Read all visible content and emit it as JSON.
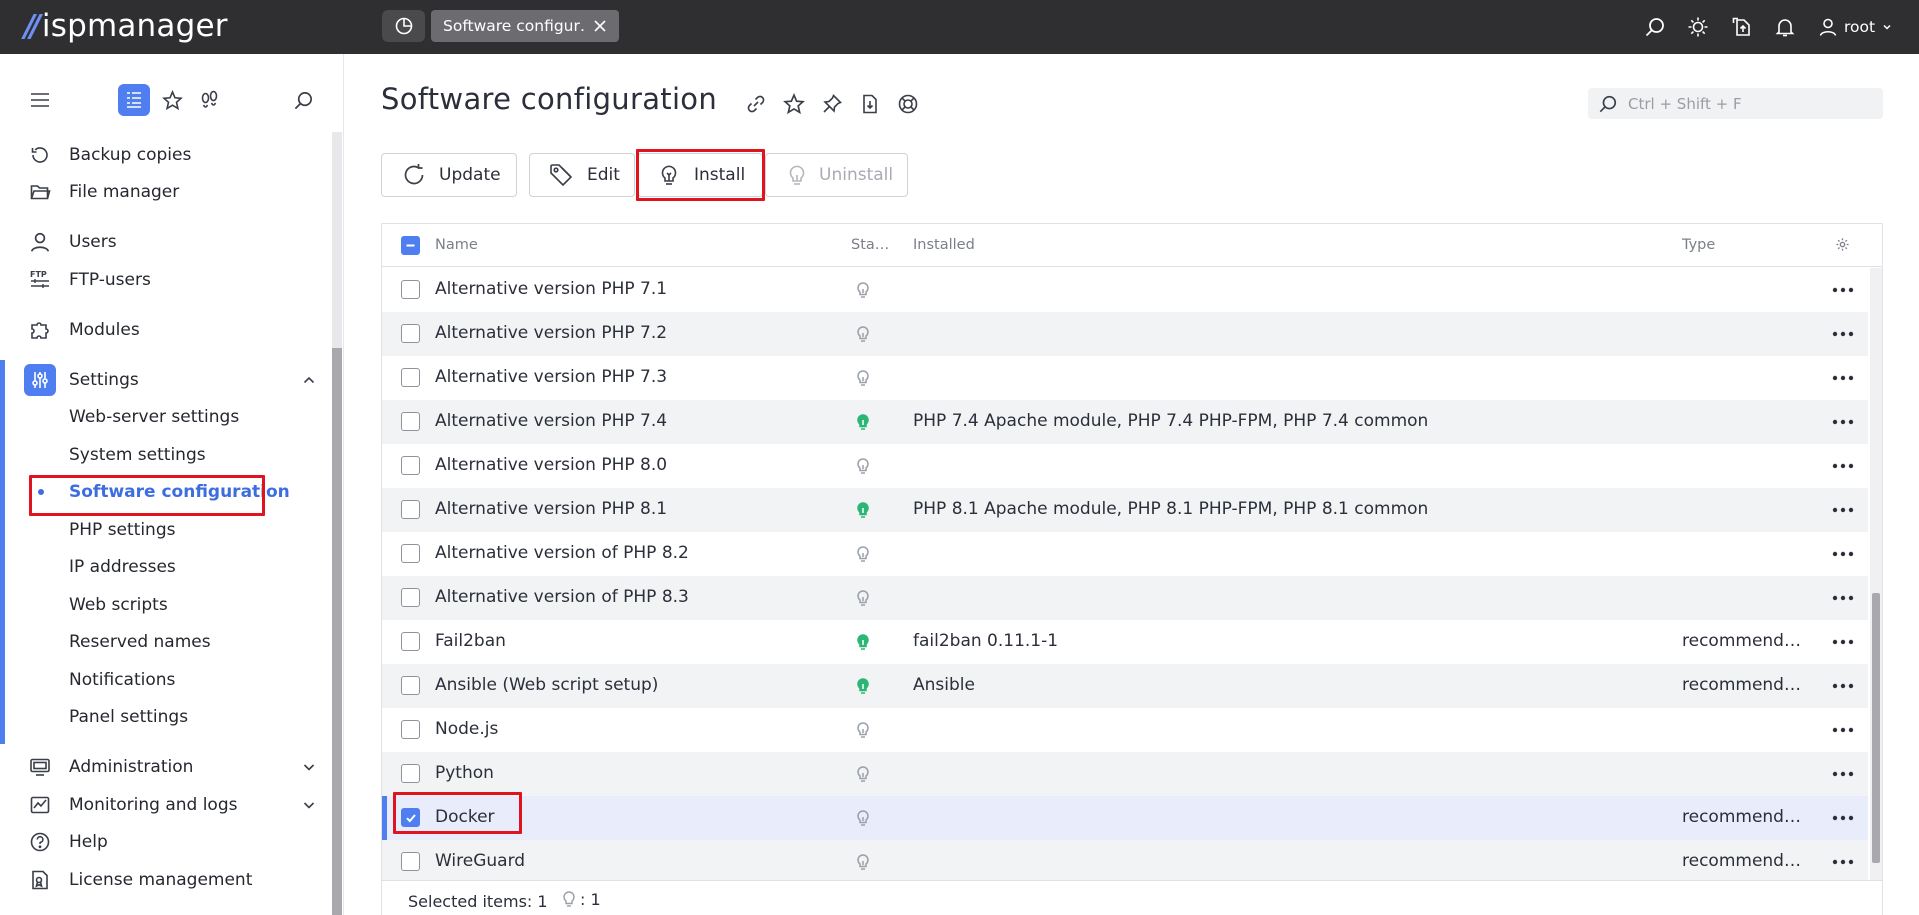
{
  "app": {
    "logo_text": "ispmanager",
    "tab_label": "Software configur…",
    "user": "root"
  },
  "sidebar": {
    "items": [
      {
        "label": "Backup copies",
        "icon": "backup-icon"
      },
      {
        "label": "File manager",
        "icon": "folder-icon"
      },
      {
        "label": "Users",
        "icon": "user-icon"
      },
      {
        "label": "FTP-users",
        "icon": "ftp-icon"
      },
      {
        "label": "Modules",
        "icon": "puzzle-icon"
      },
      {
        "label": "Settings",
        "icon": "settings-sliders-icon"
      }
    ],
    "settings_children": [
      "Web-server settings",
      "System settings",
      "Software configuration",
      "PHP settings",
      "IP addresses",
      "Web scripts",
      "Reserved names",
      "Notifications",
      "Panel settings"
    ],
    "bottom_items": [
      {
        "label": "Administration",
        "icon": "monitor-icon"
      },
      {
        "label": "Monitoring and logs",
        "icon": "chart-icon"
      },
      {
        "label": "Help",
        "icon": "help-icon"
      },
      {
        "label": "License management",
        "icon": "license-icon"
      }
    ],
    "active_item": "Software configuration"
  },
  "page": {
    "title": "Software configuration",
    "search_placeholder": "Ctrl + Shift + F"
  },
  "toolbar": {
    "update": "Update",
    "edit": "Edit",
    "install": "Install",
    "uninstall": "Uninstall"
  },
  "table": {
    "columns": {
      "name": "Name",
      "status": "Sta…",
      "installed": "Installed",
      "type": "Type"
    },
    "rows": [
      {
        "name": "Alternative version PHP 7.1",
        "installed": "",
        "type": "",
        "status": "off",
        "checked": false
      },
      {
        "name": "Alternative version PHP 7.2",
        "installed": "",
        "type": "",
        "status": "off",
        "checked": false
      },
      {
        "name": "Alternative version PHP 7.3",
        "installed": "",
        "type": "",
        "status": "off",
        "checked": false
      },
      {
        "name": "Alternative version PHP 7.4",
        "installed": "PHP 7.4 Apache module, PHP 7.4 PHP-FPM, PHP 7.4 common",
        "type": "",
        "status": "on",
        "checked": false
      },
      {
        "name": "Alternative version PHP 8.0",
        "installed": "",
        "type": "",
        "status": "off",
        "checked": false
      },
      {
        "name": "Alternative version PHP 8.1",
        "installed": "PHP 8.1 Apache module, PHP 8.1 PHP-FPM, PHP 8.1 common",
        "type": "",
        "status": "on",
        "checked": false
      },
      {
        "name": "Alternative version of PHP 8.2",
        "installed": "",
        "type": "",
        "status": "off",
        "checked": false
      },
      {
        "name": "Alternative version of PHP 8.3",
        "installed": "",
        "type": "",
        "status": "off",
        "checked": false
      },
      {
        "name": "Fail2ban",
        "installed": "fail2ban 0.11.1-1",
        "type": "recommend…",
        "status": "on",
        "checked": false
      },
      {
        "name": "Ansible (Web script setup)",
        "installed": "Ansible",
        "type": "recommend…",
        "status": "on",
        "checked": false
      },
      {
        "name": "Node.js",
        "installed": "",
        "type": "",
        "status": "off",
        "checked": false
      },
      {
        "name": "Python",
        "installed": "",
        "type": "",
        "status": "off",
        "checked": false
      },
      {
        "name": "Docker",
        "installed": "",
        "type": "recommend…",
        "status": "off",
        "checked": true
      },
      {
        "name": "WireGuard",
        "installed": "",
        "type": "recommend…",
        "status": "off",
        "checked": false
      }
    ],
    "footer_selected": "Selected items: 1",
    "footer_bulb_count": ": 1"
  },
  "colors": {
    "accent": "#4f7ef0",
    "status_on": "#2bb673",
    "status_off": "#9aa0a8",
    "highlight": "#e0141c",
    "topbar": "#2f2f31"
  }
}
